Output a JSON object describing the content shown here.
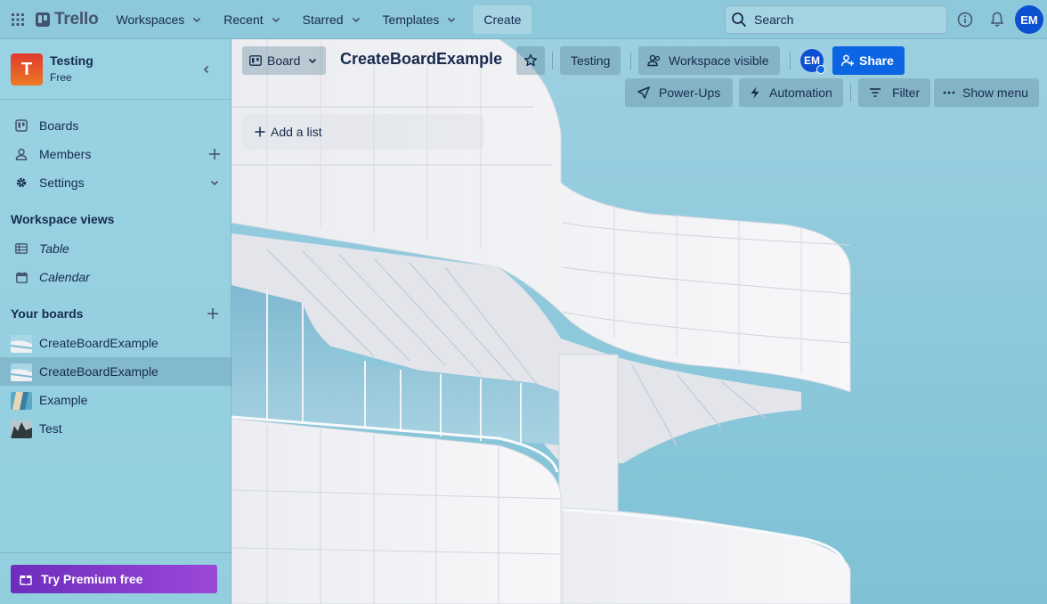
{
  "topbar": {
    "logo_text": "Trello",
    "nav": [
      {
        "label": "Workspaces"
      },
      {
        "label": "Recent"
      },
      {
        "label": "Starred"
      },
      {
        "label": "Templates"
      }
    ],
    "create_label": "Create",
    "search_placeholder": "Search",
    "avatar_initials": "EM"
  },
  "sidebar": {
    "workspace_initial": "T",
    "workspace_name": "Testing",
    "workspace_plan": "Free",
    "items": [
      {
        "label": "Boards",
        "icon": "board-icon"
      },
      {
        "label": "Members",
        "icon": "person-icon"
      },
      {
        "label": "Settings",
        "icon": "gear-icon"
      }
    ],
    "views_title": "Workspace views",
    "views": [
      {
        "label": "Table",
        "icon": "table-icon"
      },
      {
        "label": "Calendar",
        "icon": "calendar-icon"
      }
    ],
    "boards_title": "Your boards",
    "boards": [
      {
        "label": "CreateBoardExample",
        "active": false
      },
      {
        "label": "CreateBoardExample",
        "active": true
      },
      {
        "label": "Example",
        "active": false
      },
      {
        "label": "Test",
        "active": false
      }
    ],
    "premium_label": "Try Premium free"
  },
  "board": {
    "view_label": "Board",
    "title": "CreateBoardExample",
    "workspace_label": "Testing",
    "visibility_label": "Workspace visible",
    "member_initials": "EM",
    "share_label": "Share",
    "powerups_label": "Power-Ups",
    "automation_label": "Automation",
    "filter_label": "Filter",
    "menu_label": "Show menu",
    "add_list_label": "Add a list"
  },
  "colors": {
    "background": "#8ec9dc",
    "share": "#0c66e4",
    "avatar": "#0c4fd1",
    "premium_start": "#6e2dbd",
    "premium_end": "#9b48d8",
    "workspace_logo_start": "#e1392f",
    "workspace_logo_end": "#ec7a25"
  }
}
